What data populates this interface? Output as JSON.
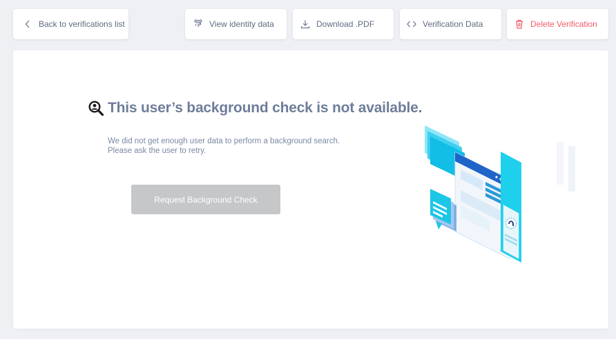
{
  "toolbar": {
    "back_label": "Back to verifications list",
    "identity_label": "View identity data",
    "pdf_label": "Download .PDF",
    "vdata_label": "Verification Data",
    "delete_label": "Delete Verification"
  },
  "main": {
    "title": "This user’s background check is not available.",
    "description_line1": "We did not get enough user data to perform a background search.",
    "description_line2": "Please ask the user to retry.",
    "request_button_label": "Request Background Check"
  },
  "icons": {
    "back": "chevron-left-icon",
    "identity": "fingerprint-icon",
    "pdf": "download-icon",
    "vdata": "code-icon",
    "delete": "trash-icon",
    "title": "user-search-icon"
  },
  "colors": {
    "background": "#eef0f4",
    "title_text": "#6f7d9a",
    "delete_accent": "#f25b6b",
    "disabled_button": "#c6c7c9",
    "illustration_accent": "#1ec6e6"
  }
}
